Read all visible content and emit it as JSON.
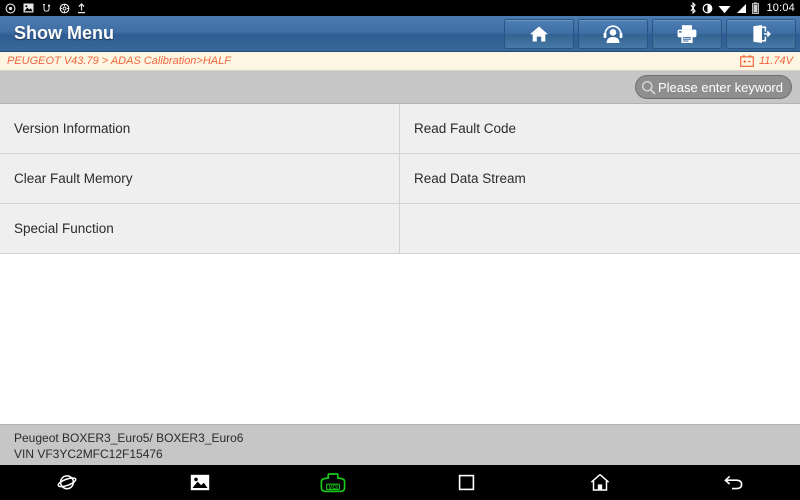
{
  "statusbar": {
    "left_icons": [
      "weather-icon",
      "screenshot-icon",
      "usb-icon",
      "settings-icon",
      "upload-icon"
    ],
    "right_icons": [
      "bluetooth-icon",
      "brightness-icon",
      "wifi-icon",
      "signal-icon",
      "battery-icon"
    ],
    "time": "10:04"
  },
  "titlebar": {
    "title": "Show Menu",
    "buttons": [
      {
        "name": "home-button",
        "icon": "home-icon"
      },
      {
        "name": "support-button",
        "icon": "headset-person-icon"
      },
      {
        "name": "print-button",
        "icon": "printer-icon"
      },
      {
        "name": "exit-button",
        "icon": "exit-door-icon"
      }
    ]
  },
  "breadcrumb": {
    "path": "PEUGEOT V43.79 > ADAS Calibration>HALF",
    "voltage": "11.74V",
    "voltage_icon": "car-battery-icon",
    "accent_color": "#f2663c"
  },
  "search": {
    "icon": "search-icon",
    "placeholder": "Please enter keyword",
    "value": ""
  },
  "menu": {
    "items": [
      {
        "label": "Version Information"
      },
      {
        "label": "Read Fault Code"
      },
      {
        "label": "Clear Fault Memory"
      },
      {
        "label": "Read Data Stream"
      },
      {
        "label": "Special Function"
      },
      {
        "label": ""
      }
    ]
  },
  "footer": {
    "vehicle": "Peugeot BOXER3_Euro5/ BOXER3_Euro6",
    "vin": "VIN VF3YC2MFC12F15476"
  },
  "navbar": {
    "items": [
      {
        "name": "browser-icon"
      },
      {
        "name": "gallery-icon"
      },
      {
        "name": "vci-icon",
        "label": "VCI"
      },
      {
        "name": "recents-icon"
      },
      {
        "name": "home-icon"
      },
      {
        "name": "back-icon"
      }
    ]
  }
}
